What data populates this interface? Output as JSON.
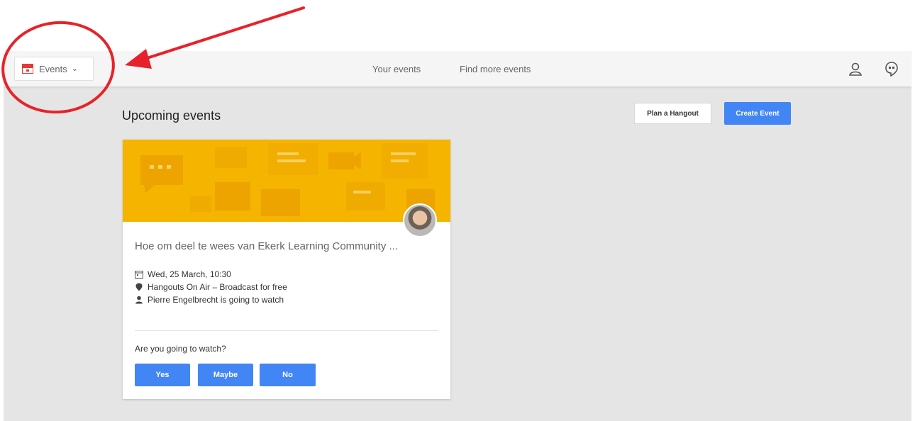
{
  "header": {
    "app_menu_label": "Events",
    "nav": [
      "Your events",
      "Find more events"
    ]
  },
  "main": {
    "section_title": "Upcoming events",
    "plan_hangout_label": "Plan a Hangout",
    "create_event_label": "Create Event"
  },
  "event_card": {
    "title": "Hoe om deel te wees van Ekerk Learning Community ...",
    "date": "Wed, 25 March, 10:30",
    "location": "Hangouts On Air – Broadcast for free",
    "attendee": "Pierre Engelbrecht is going to watch",
    "question": "Are you going to watch?",
    "rsvp": {
      "yes": "Yes",
      "maybe": "Maybe",
      "no": "No"
    }
  },
  "colors": {
    "accent": "#4285f4",
    "banner": "#f4b400",
    "annotation": "#e8222a",
    "calendar_icon": "#e53935"
  },
  "icons": [
    "calendar-icon",
    "chevron-down-icon",
    "profile-icon",
    "hangouts-icon",
    "location-pin-icon",
    "person-icon"
  ]
}
